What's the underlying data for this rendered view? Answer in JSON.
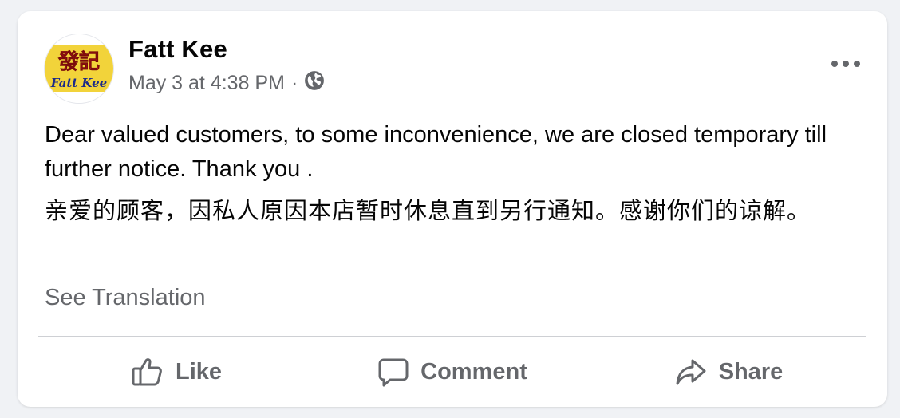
{
  "post": {
    "page_name": "Fatt Kee",
    "timestamp": "May 3 at 4:38 PM",
    "separator": "·",
    "privacy_icon": "globe-icon",
    "avatar": {
      "logo_chinese": "發記",
      "logo_english": "Fatt Kee",
      "colors": {
        "background": "#f2d33a",
        "chinese_text": "#d81f1f",
        "english_text": "#1b2a8a"
      }
    },
    "body_en": "Dear valued customers, to some inconvenience, we are closed temporary till further notice. Thank you .",
    "body_zh": "亲爱的顾客，因私人原因本店暂时休息直到另行通知。感谢你们的谅解。",
    "see_translation": "See Translation"
  },
  "actions": {
    "like": {
      "label": "Like",
      "icon": "thumbs-up-icon"
    },
    "comment": {
      "label": "Comment",
      "icon": "speech-bubble-icon"
    },
    "share": {
      "label": "Share",
      "icon": "share-arrow-icon"
    }
  },
  "colors": {
    "background": "#f0f2f5",
    "card": "#ffffff",
    "primary_text": "#050505",
    "secondary_text": "#65676b",
    "divider": "#ced0d4"
  }
}
